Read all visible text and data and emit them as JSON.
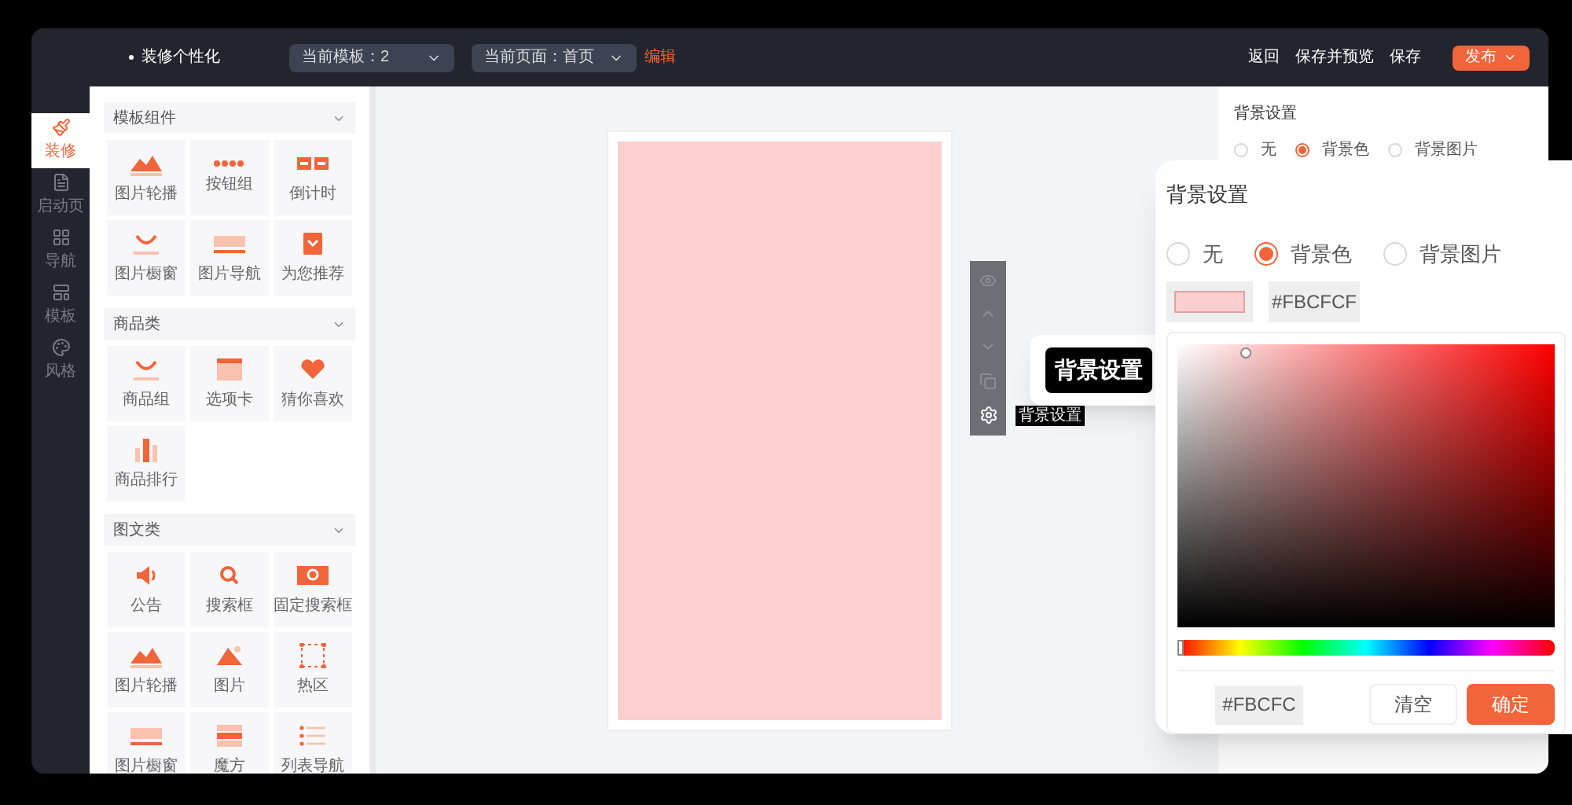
{
  "header": {
    "title": "装修个性化",
    "template_select": "当前模板：2",
    "page_select": "当前页面：首页",
    "edit_link": "编辑",
    "actions": [
      "返回",
      "保存并预览",
      "保存"
    ],
    "publish": "发布"
  },
  "nav": [
    {
      "label": "装修",
      "kind": "brush",
      "selected": true
    },
    {
      "label": "启动页",
      "kind": "page",
      "selected": false
    },
    {
      "label": "导航",
      "kind": "grid",
      "selected": false
    },
    {
      "label": "模板",
      "kind": "layout",
      "selected": false
    },
    {
      "label": "风格",
      "kind": "palette",
      "selected": false
    }
  ],
  "groups": [
    {
      "title": "模板组件",
      "items": [
        {
          "label": "图片轮播",
          "kind": "mountains"
        },
        {
          "label": "按钮组",
          "kind": "dots"
        },
        {
          "label": "倒计时",
          "kind": "countdown"
        },
        {
          "label": "图片橱窗",
          "kind": "bag"
        },
        {
          "label": "图片导航",
          "kind": "strip"
        },
        {
          "label": "为您推荐",
          "kind": "gift"
        }
      ]
    },
    {
      "title": "商品类",
      "items": [
        {
          "label": "商品组",
          "kind": "bag"
        },
        {
          "label": "选项卡",
          "kind": "tabs"
        },
        {
          "label": "猜你喜欢",
          "kind": "heart"
        },
        {
          "label": "商品排行",
          "kind": "bars"
        }
      ]
    },
    {
      "title": "图文类",
      "items": [
        {
          "label": "公告",
          "kind": "speaker"
        },
        {
          "label": "搜索框",
          "kind": "search"
        },
        {
          "label": "固定搜索框",
          "kind": "searchbar"
        },
        {
          "label": "图片轮播",
          "kind": "mountains"
        },
        {
          "label": "图片",
          "kind": "image"
        },
        {
          "label": "热区",
          "kind": "frame"
        },
        {
          "label": "图片橱窗",
          "kind": "strip"
        },
        {
          "label": "魔方",
          "kind": "grid"
        },
        {
          "label": "列表导航",
          "kind": "list"
        }
      ]
    }
  ],
  "toolbar": {
    "tooltip": "背景设置",
    "callout": "背景设置"
  },
  "settings": {
    "title": "背景设置",
    "options": [
      {
        "label": "无",
        "selected": false
      },
      {
        "label": "背景色",
        "selected": true
      },
      {
        "label": "背景图片",
        "selected": false
      }
    ]
  },
  "popup": {
    "title": "背景设置",
    "options": [
      {
        "label": "无",
        "selected": false
      },
      {
        "label": "背景色",
        "selected": true
      },
      {
        "label": "背景图片",
        "selected": false
      }
    ],
    "hex": "#FBCFCF",
    "hue": {
      "level": 0
    },
    "hex_input": "#FBCFC",
    "clear": "清空",
    "confirm": "确定"
  }
}
